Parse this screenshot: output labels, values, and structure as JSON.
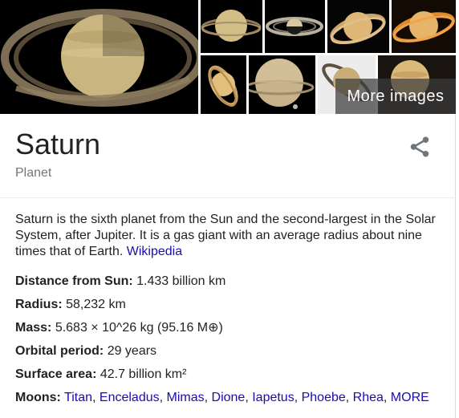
{
  "images": {
    "more_label": "More images"
  },
  "entity": {
    "title": "Saturn",
    "subtitle": "Planet",
    "description": "Saturn is the sixth planet from the Sun and the second-largest in the Solar System, after Jupiter. It is a gas giant with an average radius about nine times that of Earth.",
    "source_link": "Wikipedia"
  },
  "facts": {
    "distance": {
      "label": "Distance from Sun:",
      "value": "1.433 billion km"
    },
    "radius": {
      "label": "Radius:",
      "value": "58,232 km"
    },
    "mass": {
      "label": "Mass:",
      "value": "5.683 × 10^26 kg (95.16 M⊕)"
    },
    "orbital_period": {
      "label": "Orbital period:",
      "value": "29 years"
    },
    "surface_area": {
      "label": "Surface area:",
      "value": "42.7 billion km²"
    },
    "moons": {
      "label": "Moons:",
      "items": [
        "Titan",
        "Enceladus",
        "Mimas",
        "Dione",
        "Iapetus",
        "Phoebe",
        "Rhea",
        "MORE"
      ]
    }
  },
  "icons": {
    "share": "share-icon"
  },
  "colors": {
    "link": "#1a0dab",
    "subtitle": "#70757a"
  }
}
